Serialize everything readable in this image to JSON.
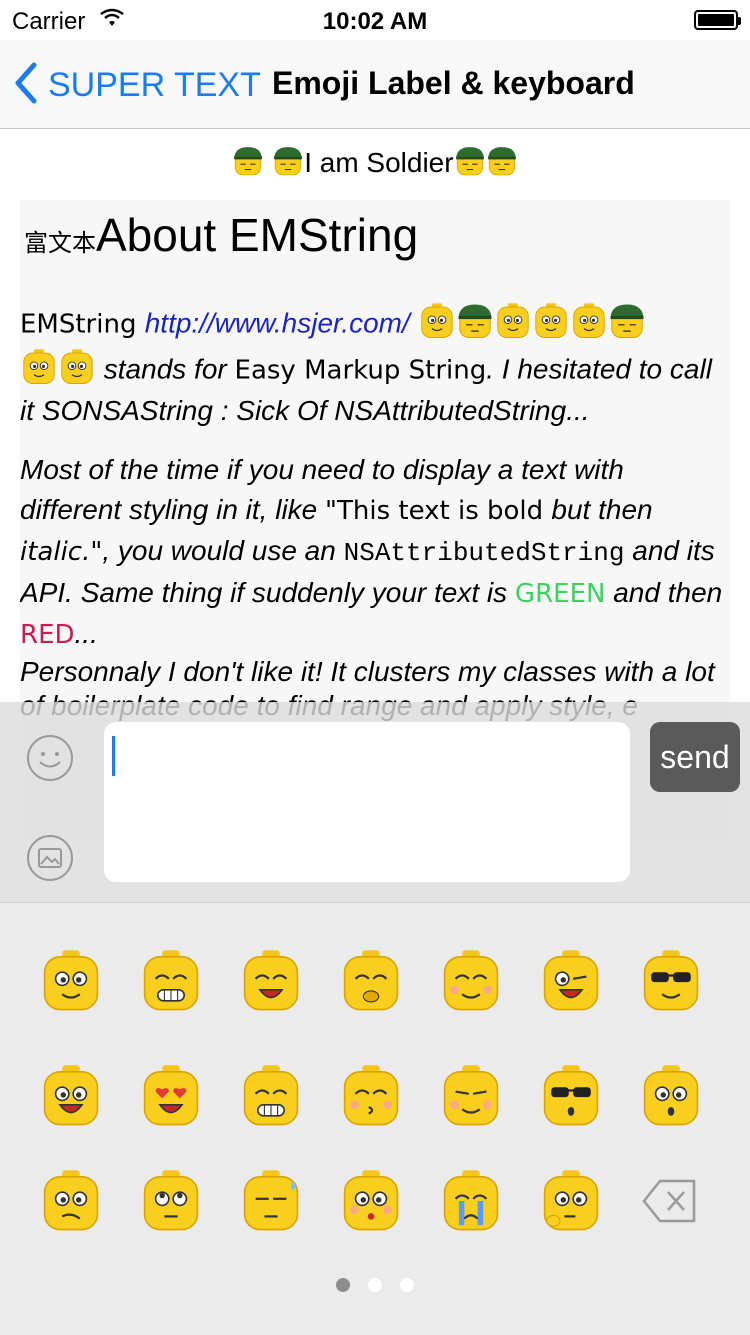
{
  "status_bar": {
    "carrier": "Carrier",
    "time": "10:02 AM"
  },
  "nav": {
    "back_label": "SUPER TEXT",
    "title": "Emoji Label & keyboard"
  },
  "content": {
    "soldier_text": "I am Soldier",
    "heading_cjk": "富文本",
    "heading": "About EMString",
    "p1_lead": "EMString ",
    "p1_link": "http://www.hsjer.com/",
    "p1_stands": " stands for ",
    "p1_easy": "Easy Markup String",
    "p1_rest": ". I hesitated to call it SONSAString : Sick Of NSAttributedString...",
    "p2_a": "Most of the time if you need to display a text with different styling in it, like ",
    "p2_quote": "\"This text is bold ",
    "p2_but": "but then ",
    "p2_italic": "italic.\"",
    "p2_b": ", you would use an ",
    "p2_mono": "NSAttributedString",
    "p2_c": " and its API. Same thing if suddenly your text is ",
    "p2_green": "GREEN",
    "p2_d": " and then ",
    "p2_red": "RED",
    "p2_e": "...",
    "p3": "Personnaly I don't like it! It clusters my classes with a lot of boilerplate code to find range and apply style, e"
  },
  "input": {
    "send_label": "send"
  },
  "colors": {
    "accent": "#1b7cf2",
    "link": "#1a22c8",
    "green": "#3bd25f",
    "red": "#c81d4f",
    "send_bg": "#5a5a5a"
  },
  "keyboard": {
    "rows": [
      [
        "smile-emoji",
        "grin-emoji",
        "laugh-emoji",
        "shy-emoji",
        "blush-emoji",
        "wink-tongue-emoji",
        "cool-emoji"
      ],
      [
        "excited-emoji",
        "heart-eyes-emoji",
        "big-grin-emoji",
        "kiss-emoji",
        "content-emoji",
        "sunglasses-emoji",
        "surprised-emoji"
      ],
      [
        "confused-emoji",
        "rolling-eyes-emoji",
        "sweat-emoji",
        "teary-emoji",
        "crying-emoji",
        "thinking-emoji",
        "backspace-icon"
      ]
    ],
    "page_count": 3,
    "current_page": 1
  }
}
